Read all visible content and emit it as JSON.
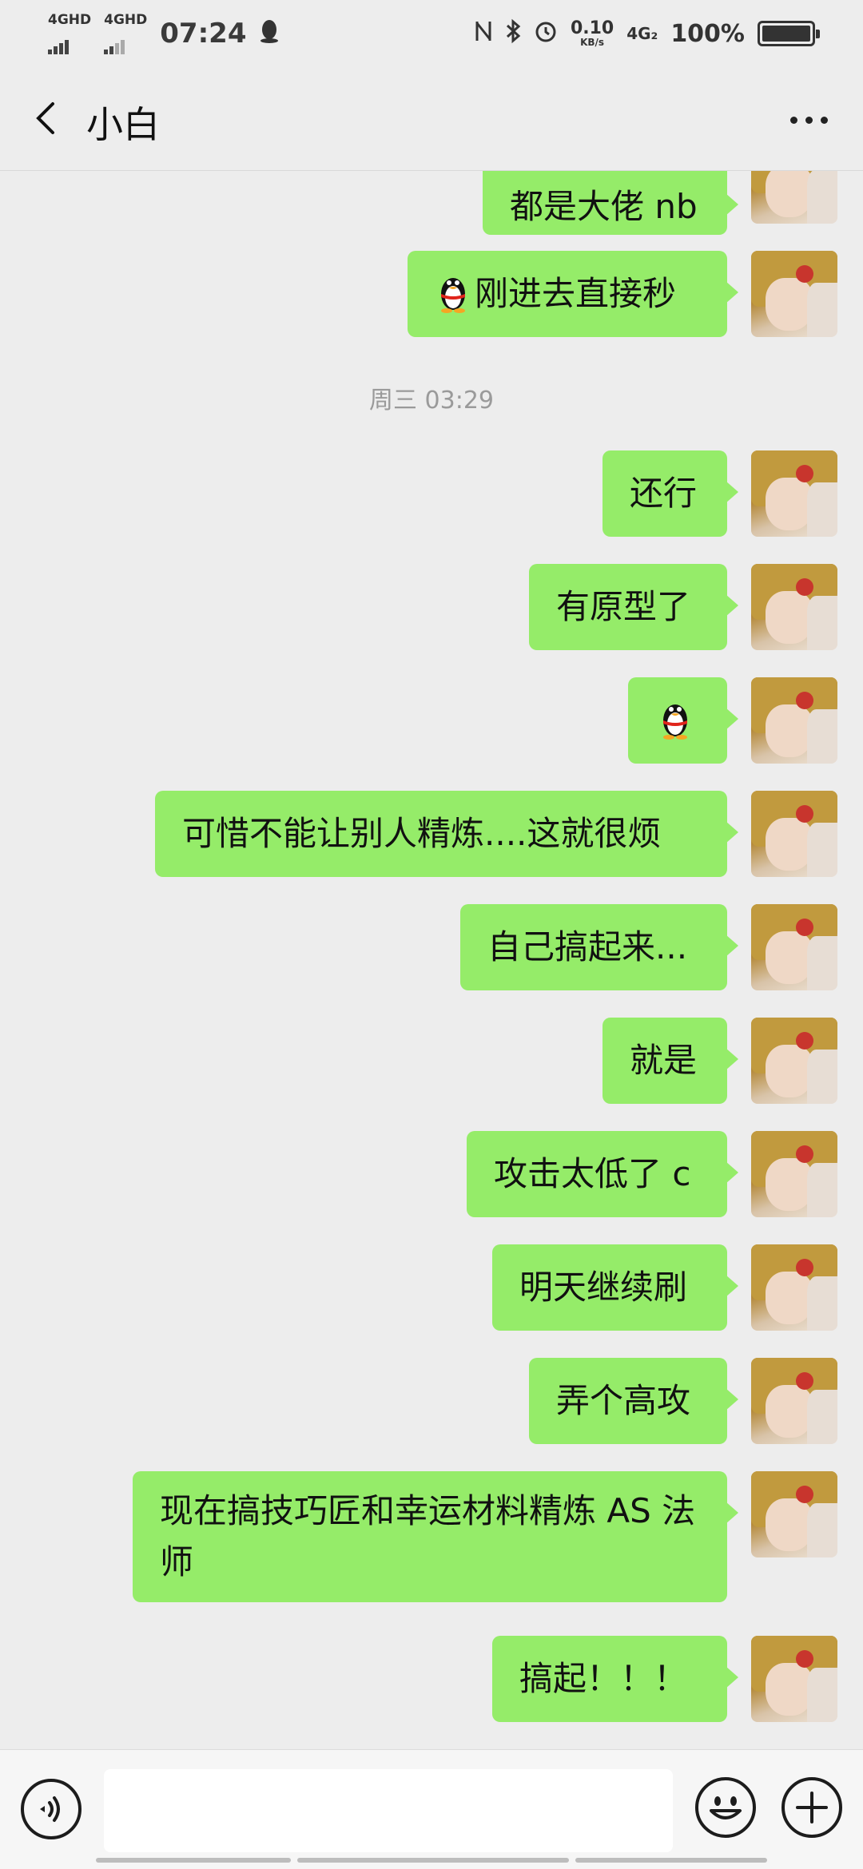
{
  "status_bar": {
    "net1": "4GHD",
    "net2": "4GHD",
    "time": "07:24",
    "speed_value": "0.10",
    "speed_unit": "KB/s",
    "net_type": "4G₂",
    "battery": "100%"
  },
  "header": {
    "title": "小白"
  },
  "messages": [
    {
      "text": "都是大佬 nb",
      "emoji": false
    },
    {
      "text": "刚进去直接秒",
      "emoji": true
    },
    {
      "text": "还行",
      "emoji": false
    },
    {
      "text": "有原型了",
      "emoji": false
    },
    {
      "text": "",
      "emoji": true
    },
    {
      "text": "可惜不能让别人精炼....这就很烦",
      "emoji": false
    },
    {
      "text": "自己搞起来...",
      "emoji": false
    },
    {
      "text": "就是",
      "emoji": false
    },
    {
      "text": "攻击太低了 c",
      "emoji": false
    },
    {
      "text": "明天继续刷",
      "emoji": false
    },
    {
      "text": "弄个高攻",
      "emoji": false
    },
    {
      "text": "现在搞技巧匠和幸运材料精炼 AS 法师",
      "emoji": false
    },
    {
      "text": "搞起！！！",
      "emoji": false
    }
  ],
  "time_separator": "周三 03:29",
  "icons": {
    "back": "back-arrow-icon",
    "more": "more-dots-icon",
    "voice": "voice-icon",
    "emoji": "emoji-icon",
    "plus": "plus-icon",
    "qq": "qq-penguin-icon"
  },
  "colors": {
    "bubble": "#95ec69",
    "background": "#ededed"
  }
}
